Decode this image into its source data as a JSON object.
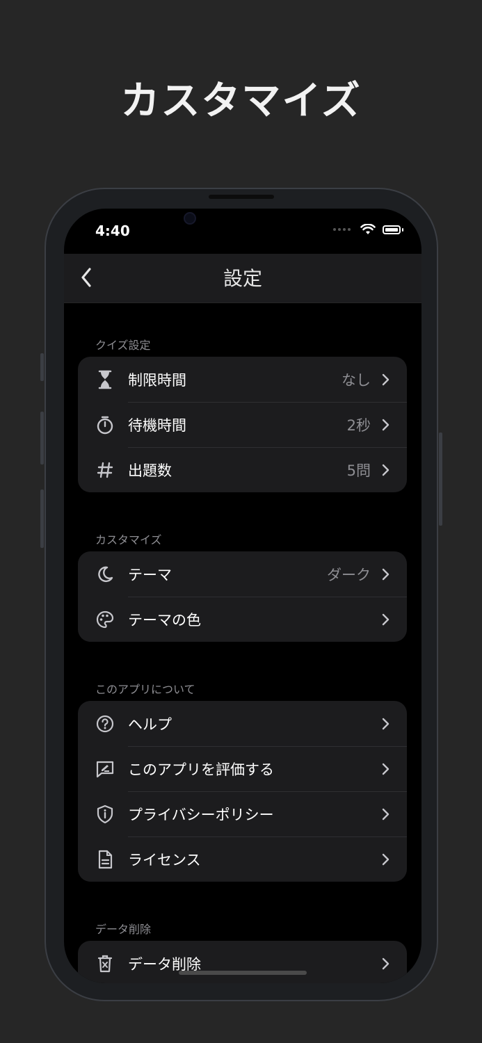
{
  "headline": "カスタマイズ",
  "status": {
    "time": "4:40"
  },
  "nav": {
    "title": "設定"
  },
  "sections": [
    {
      "header": "クイズ設定",
      "rows": [
        {
          "icon": "hourglass-icon",
          "label": "制限時間",
          "value": "なし"
        },
        {
          "icon": "stopwatch-icon",
          "label": "待機時間",
          "value": "2秒"
        },
        {
          "icon": "hash-icon",
          "label": "出題数",
          "value": "5問"
        }
      ]
    },
    {
      "header": "カスタマイズ",
      "rows": [
        {
          "icon": "moon-icon",
          "label": "テーマ",
          "value": "ダーク"
        },
        {
          "icon": "palette-icon",
          "label": "テーマの色",
          "value": ""
        }
      ]
    },
    {
      "header": "このアプリについて",
      "rows": [
        {
          "icon": "question-icon",
          "label": "ヘルプ",
          "value": ""
        },
        {
          "icon": "review-icon",
          "label": "このアプリを評価する",
          "value": ""
        },
        {
          "icon": "shield-info-icon",
          "label": "プライバシーポリシー",
          "value": ""
        },
        {
          "icon": "document-icon",
          "label": "ライセンス",
          "value": ""
        }
      ]
    },
    {
      "header": "データ削除",
      "rows": [
        {
          "icon": "trash-icon",
          "label": "データ削除",
          "value": ""
        }
      ]
    }
  ],
  "colors": {
    "background": "#262626",
    "screen": "#000000",
    "cell": "#1c1c1e",
    "secondary_text": "#8e8e93"
  }
}
